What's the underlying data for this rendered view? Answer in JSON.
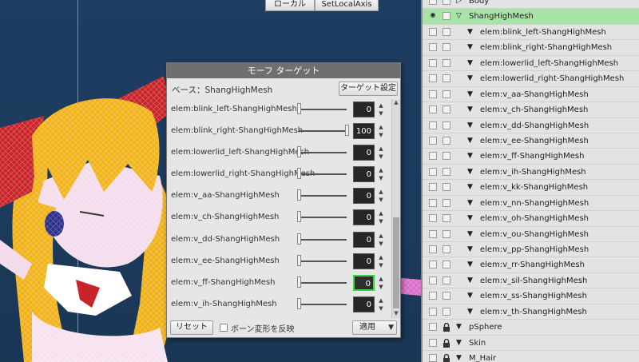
{
  "viewport": {
    "toolbar_buttons": [
      "ローカル",
      "SetLocalAxis"
    ]
  },
  "dialog": {
    "title": "モーフ ターゲット",
    "base_label": "ベース：ShangHighMesh",
    "target_settings_button": "ターゲット設定",
    "targets": [
      {
        "name": "elem:blink_left-ShangHighMesh",
        "value": "0",
        "level": 0
      },
      {
        "name": "elem:blink_right-ShangHighMesh",
        "value": "100",
        "level": 100
      },
      {
        "name": "elem:lowerlid_left-ShangHighMesh",
        "value": "0",
        "level": 0
      },
      {
        "name": "elem:lowerlid_right-ShangHighMesh",
        "value": "0",
        "level": 0
      },
      {
        "name": "elem:v_aa-ShangHighMesh",
        "value": "0",
        "level": 0
      },
      {
        "name": "elem:v_ch-ShangHighMesh",
        "value": "0",
        "level": 0
      },
      {
        "name": "elem:v_dd-ShangHighMesh",
        "value": "0",
        "level": 0
      },
      {
        "name": "elem:v_ee-ShangHighMesh",
        "value": "0",
        "level": 0
      },
      {
        "name": "elem:v_ff-ShangHighMesh",
        "value": "0",
        "level": 0,
        "active": true
      },
      {
        "name": "elem:v_ih-ShangHighMesh",
        "value": "0",
        "level": 0
      }
    ],
    "reset_button": "リセット",
    "invert_label": "ボーン変形を反映",
    "apply_button": "適用"
  },
  "outliner": {
    "rows": [
      {
        "label": "Body",
        "lock": false,
        "arrow": "right-outline",
        "indent": 1
      },
      {
        "label": "ShangHighMesh",
        "lock": false,
        "arrow": "down-outline",
        "indent": 1,
        "selected": true,
        "eye": "◉◉"
      },
      {
        "label": "elem:blink_left-ShangHighMesh",
        "lock": false,
        "arrow": "down",
        "indent": 2
      },
      {
        "label": "elem:blink_right-ShangHighMesh",
        "lock": false,
        "arrow": "down",
        "indent": 2
      },
      {
        "label": "elem:lowerlid_left-ShangHighMesh",
        "lock": false,
        "arrow": "down",
        "indent": 2
      },
      {
        "label": "elem:lowerlid_right-ShangHighMesh",
        "lock": false,
        "arrow": "down",
        "indent": 2
      },
      {
        "label": "elem:v_aa-ShangHighMesh",
        "lock": false,
        "arrow": "down",
        "indent": 2
      },
      {
        "label": "elem:v_ch-ShangHighMesh",
        "lock": false,
        "arrow": "down",
        "indent": 2
      },
      {
        "label": "elem:v_dd-ShangHighMesh",
        "lock": false,
        "arrow": "down",
        "indent": 2
      },
      {
        "label": "elem:v_ee-ShangHighMesh",
        "lock": false,
        "arrow": "down",
        "indent": 2
      },
      {
        "label": "elem:v_ff-ShangHighMesh",
        "lock": false,
        "arrow": "down",
        "indent": 2
      },
      {
        "label": "elem:v_ih-ShangHighMesh",
        "lock": false,
        "arrow": "down",
        "indent": 2
      },
      {
        "label": "elem:v_kk-ShangHighMesh",
        "lock": false,
        "arrow": "down",
        "indent": 2
      },
      {
        "label": "elem:v_nn-ShangHighMesh",
        "lock": false,
        "arrow": "down",
        "indent": 2
      },
      {
        "label": "elem:v_oh-ShangHighMesh",
        "lock": false,
        "arrow": "down",
        "indent": 2
      },
      {
        "label": "elem:v_ou-ShangHighMesh",
        "lock": false,
        "arrow": "down",
        "indent": 2
      },
      {
        "label": "elem:v_pp-ShangHighMesh",
        "lock": false,
        "arrow": "down",
        "indent": 2
      },
      {
        "label": "elem:v_rr-ShangHighMesh",
        "lock": false,
        "arrow": "down",
        "indent": 2
      },
      {
        "label": "elem:v_sil-ShangHighMesh",
        "lock": false,
        "arrow": "down",
        "indent": 2
      },
      {
        "label": "elem:v_ss-ShangHighMesh",
        "lock": false,
        "arrow": "down",
        "indent": 2
      },
      {
        "label": "elem:v_th-ShangHighMesh",
        "lock": false,
        "arrow": "down",
        "indent": 2
      },
      {
        "label": "pSphere",
        "lock": true,
        "arrow": "down",
        "indent": 0
      },
      {
        "label": "Skin",
        "lock": true,
        "arrow": "down",
        "indent": 0
      },
      {
        "label": "M_Hair",
        "lock": true,
        "arrow": "down",
        "indent": 0
      }
    ]
  }
}
